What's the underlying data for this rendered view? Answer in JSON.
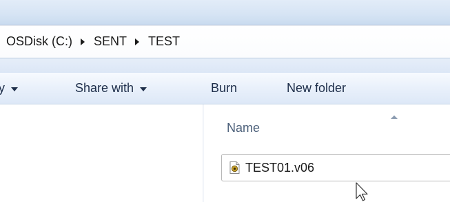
{
  "address_bar": {
    "breadcrumb": [
      "OSDisk (C:)",
      "SENT",
      "TEST"
    ]
  },
  "toolbar": {
    "organize_partial_label": "y",
    "share_with_label": "Share with",
    "burn_label": "Burn",
    "new_folder_label": "New folder"
  },
  "file_list": {
    "column_name": "Name",
    "sort": "ascending",
    "files": [
      {
        "name": "TEST01.v06",
        "icon": "media-file-icon"
      }
    ]
  },
  "colors": {
    "title_strip": "#d6e4f4",
    "toolbar": "#eaf1fb",
    "column_header_text": "#4c607a",
    "toolbar_text": "#1e2e4a"
  }
}
